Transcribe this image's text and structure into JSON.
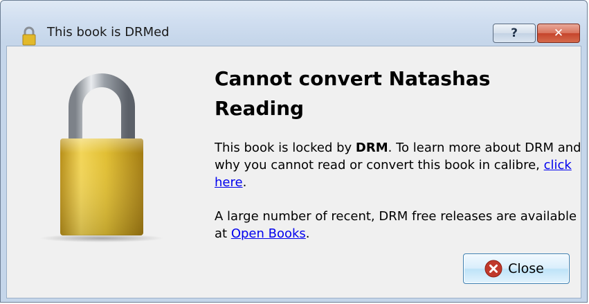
{
  "window": {
    "title": "This book is DRMed",
    "title_icon": "padlock-icon",
    "help_label": "?",
    "close_label": "✕"
  },
  "content": {
    "heading": "Cannot convert Natashas Reading",
    "paragraph1": {
      "text_before": "This book is locked by ",
      "bold": "DRM",
      "text_after": ". To learn more about DRM and why you cannot read or convert this book in calibre, ",
      "link": "click here",
      "end": "."
    },
    "paragraph2": {
      "text_before": "A large number of recent, DRM free releases are available at ",
      "link": "Open Books",
      "end": "."
    },
    "illustration": "padlock-icon"
  },
  "buttons": {
    "close_label": "Close",
    "close_icon": "close-circle-icon"
  },
  "colors": {
    "link": "#0000ee",
    "lock_gold": "#d9b82a",
    "close_red": "#c0392b"
  }
}
